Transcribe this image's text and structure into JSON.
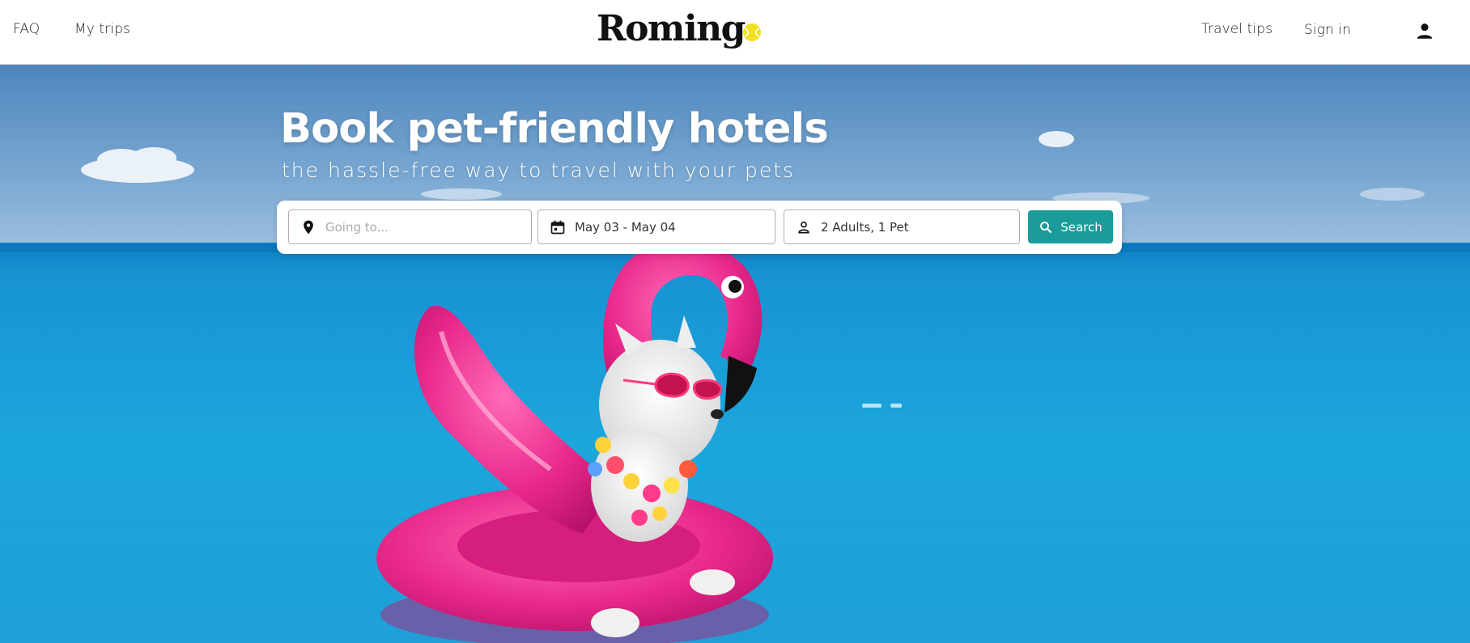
{
  "header": {
    "nav_left": [
      {
        "label": "FAQ"
      },
      {
        "label": "My trips"
      }
    ],
    "logo_text": "Roming",
    "nav_right": [
      {
        "label": "Travel tips"
      },
      {
        "label": "Sign in"
      }
    ],
    "account_icon": "person-icon"
  },
  "hero": {
    "title": "Book pet-friendly hotels",
    "subtitle": "the hassle-free way to travel with your pets",
    "image_subject": "dog-on-pink-flamingo-float-in-pool"
  },
  "search": {
    "destination": {
      "icon": "location-pin-icon",
      "placeholder": "Going to...",
      "value": ""
    },
    "dates": {
      "icon": "calendar-icon",
      "value": "May 03 - May 04"
    },
    "guests": {
      "icon": "person-icon",
      "value": "2 Adults, 1 Pet"
    },
    "button": {
      "icon": "search-icon",
      "label": "Search"
    }
  },
  "colors": {
    "accent": "#1a9c9b",
    "logo_ball": "#f0e020",
    "flamingo": "#e8288a",
    "sky": "#5b93c4",
    "water": "#1ba1d9"
  }
}
